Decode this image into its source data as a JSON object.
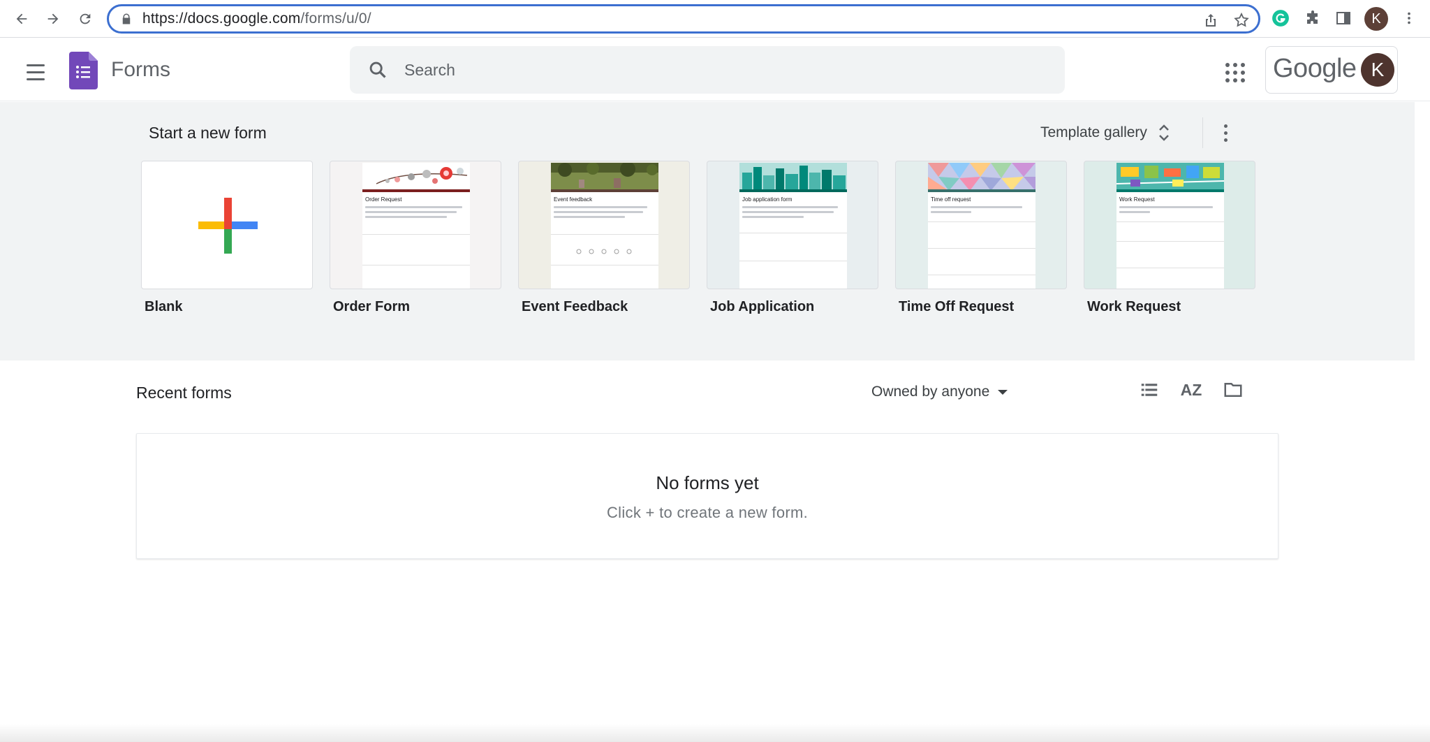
{
  "browser": {
    "url_host": "https://docs.google.com",
    "url_path": "/forms/u/0/",
    "profile_initial": "K"
  },
  "header": {
    "app_title": "Forms",
    "search_placeholder": "Search",
    "google_wordmark": "Google",
    "avatar_initial": "K"
  },
  "templates_section": {
    "title": "Start a new form",
    "gallery_label": "Template gallery",
    "items": [
      {
        "label": "Blank"
      },
      {
        "label": "Order Form",
        "doc_title": "Order Request"
      },
      {
        "label": "Event Feedback",
        "doc_title": "Event feedback"
      },
      {
        "label": "Job Application",
        "doc_title": "Job application form"
      },
      {
        "label": "Time Off Request",
        "doc_title": "Time off request"
      },
      {
        "label": "Work Request",
        "doc_title": "Work Request"
      }
    ]
  },
  "recent": {
    "title": "Recent forms",
    "owner_filter": "Owned by anyone",
    "sort_label": "AZ",
    "empty_title": "No forms yet",
    "empty_subtitle": "Click + to create a new form."
  },
  "colors": {
    "forms_purple": "#7248b9",
    "omnibox_border": "#3c6fd0",
    "template_bg": "#f1f3f4"
  }
}
